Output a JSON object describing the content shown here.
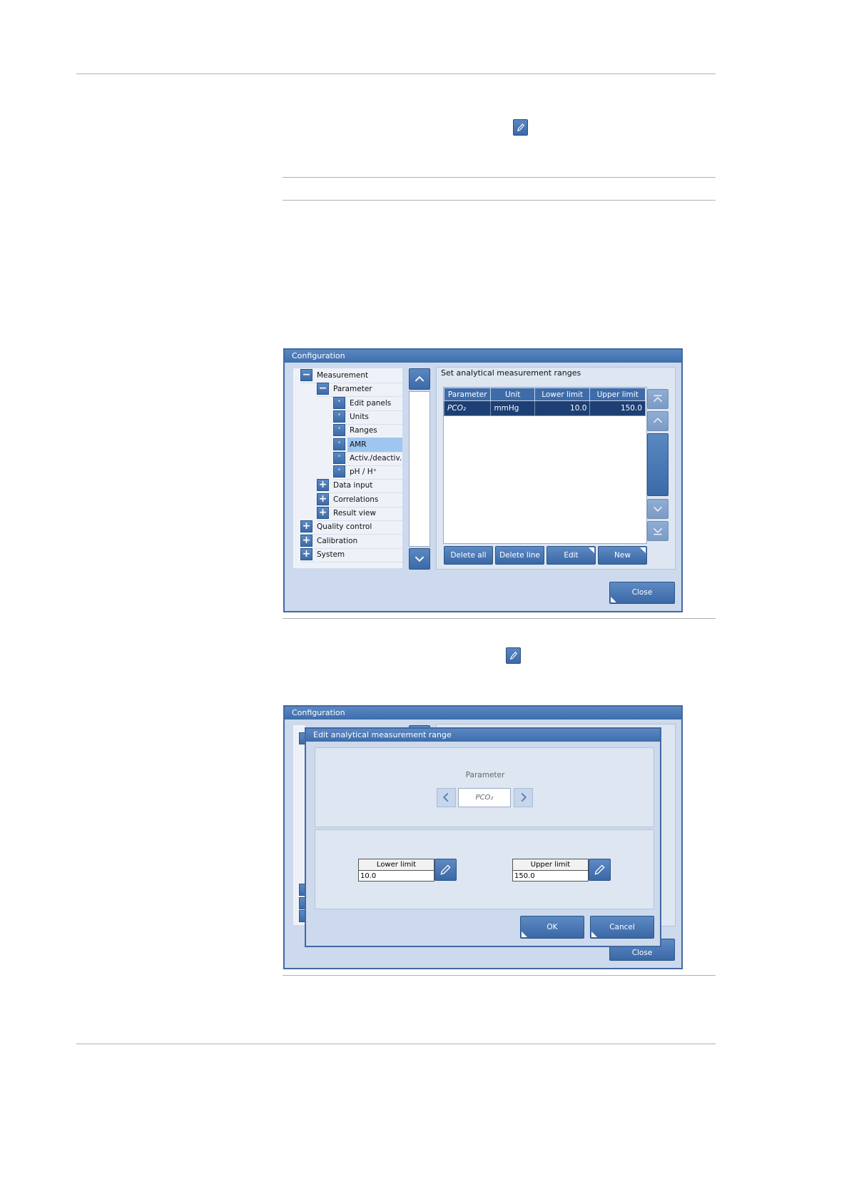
{
  "window": {
    "title": "Configuration",
    "tree": [
      {
        "label": "Measurement",
        "toggle": "−"
      },
      {
        "label": "Parameter",
        "toggle": "−"
      },
      {
        "label": "Edit panels",
        "toggle": "·"
      },
      {
        "label": "Units",
        "toggle": "·"
      },
      {
        "label": "Ranges",
        "toggle": "·"
      },
      {
        "label": "AMR",
        "toggle": "·"
      },
      {
        "label": "Activ./deactiv.",
        "toggle": "·"
      },
      {
        "label": "pH / H⁺",
        "toggle": "·"
      },
      {
        "label": "Data input",
        "toggle": "+"
      },
      {
        "label": "Correlations",
        "toggle": "+"
      },
      {
        "label": "Result view",
        "toggle": "+"
      },
      {
        "label": "Quality control",
        "toggle": "+"
      },
      {
        "label": "Calibration",
        "toggle": "+"
      },
      {
        "label": "System",
        "toggle": "+"
      }
    ],
    "section_title": "Set analytical measurement ranges",
    "table": {
      "headers": [
        "Parameter",
        "Unit",
        "Lower limit",
        "Upper limit"
      ],
      "rows": [
        {
          "parameter": "PCO₂",
          "unit": "mmHg",
          "lower": "10.0",
          "upper": "150.0"
        }
      ]
    },
    "buttons": {
      "delete_all": "Delete all",
      "delete_line": "Delete line",
      "edit": "Edit",
      "new": "New",
      "close": "Close"
    }
  },
  "dialog": {
    "title": "Edit analytical measurement range",
    "parameter_label": "Parameter",
    "parameter_value": "PCO₂",
    "lower_label": "Lower limit",
    "lower_value": "10.0",
    "upper_label": "Upper limit",
    "upper_value": "150.0",
    "ok": "OK",
    "cancel": "Cancel"
  },
  "background_window": {
    "title": "Configuration",
    "close": "Close"
  }
}
